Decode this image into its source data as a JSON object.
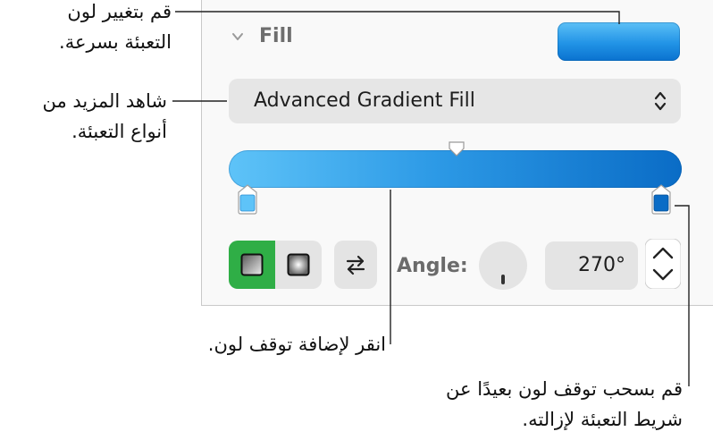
{
  "panel": {
    "section_title": "Fill",
    "gradient_type": "Advanced Gradient Fill",
    "angle_label": "Angle:",
    "angle_value": "270°",
    "fill_colors": {
      "swatch_top": "#5cc0f6",
      "swatch_bottom": "#0a72cf",
      "bar_start": "#5ec3f8",
      "bar_end": "#0a6cc6",
      "selected_toggle": "#2fae46"
    }
  },
  "callouts": {
    "quick_color": [
      "قم بتغيير لون",
      "التعبئة بسرعة."
    ],
    "more_fills": [
      "شاهد المزيد من",
      "أنواع التعبئة."
    ],
    "add_stop": "انقر لإضافة توقف لون.",
    "remove_stop": [
      "قم بسحب توقف لون بعيدًا عن",
      "شريط التعبئة لإزالته."
    ]
  },
  "icons": [
    "chevron-down-icon",
    "up-down-arrows-icon",
    "linear-gradient-icon",
    "radial-gradient-icon",
    "swap-arrows-icon",
    "angle-dial-icon",
    "stepper-icon"
  ]
}
